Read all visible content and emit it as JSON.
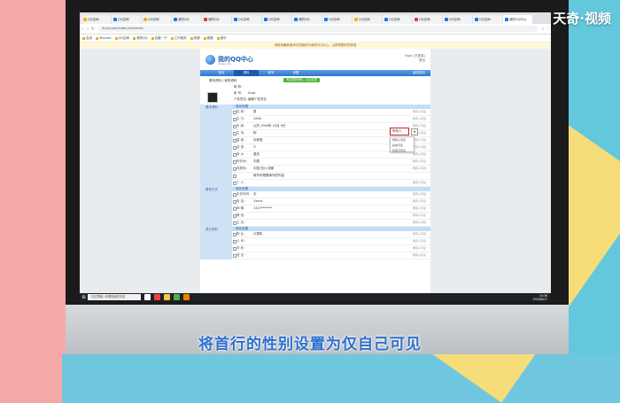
{
  "overlay": {
    "watermark": "天奇·视频",
    "caption": "将首行的性别设置为仅自己可见"
  },
  "browser": {
    "tabs": [
      {
        "label": "QQ空间",
        "color": "#f2b400"
      },
      {
        "label": "QQ空间",
        "color": "#1a73e8"
      },
      {
        "label": "QQ空间",
        "color": "#f2b400"
      },
      {
        "label": "我的QQ",
        "color": "#1a73e8"
      },
      {
        "label": "我的QQ",
        "color": "#e53935"
      },
      {
        "label": "QQ空间",
        "color": "#1a73e8"
      },
      {
        "label": "QQ空间",
        "color": "#1a73e8"
      },
      {
        "label": "我的QQ",
        "color": "#1a73e8"
      },
      {
        "label": "QQ空间",
        "color": "#1a73e8"
      },
      {
        "label": "QQ空间",
        "color": "#f2b400"
      },
      {
        "label": "QQ空间",
        "color": "#1a73e8"
      },
      {
        "label": "QQ空间",
        "color": "#e53935"
      },
      {
        "label": "QQ空间",
        "color": "#1a73e8"
      },
      {
        "label": "QQ空间",
        "color": "#1a73e8"
      },
      {
        "label": "我的QQ中心",
        "color": "#1a73e8"
      }
    ],
    "url": "id.qq.com/index.html#info",
    "bookmarks": [
      "应用",
      "Tencent",
      "QQ空间",
      "我的QQ",
      "百度一下",
      "工作相关",
      "资源",
      "视频",
      "音乐"
    ],
    "notice": "请使用最新版本浏览器访问我的QQ中心，以获得更好的体验"
  },
  "qq": {
    "title": "我的QQ中心",
    "subtitle": "id.qq.com",
    "user_right": "Nupt (已登录)",
    "user_right2": "退出",
    "nav": [
      "首页",
      "资料",
      "帐号",
      "设置"
    ],
    "nav_right": "返回首页",
    "breadcrumb": "基本资料  |  我的资料",
    "green_button": "完善更多资料，点击这里",
    "profile": {
      "nick_label": "昵  称：",
      "nick_value": "",
      "account_label": "帐  号：",
      "account_value": "Nupt",
      "sign_label": "个性签名：",
      "sign_value": "编辑个性签名"
    },
    "sections": [
      {
        "name": "基本资料",
        "header": "保存设置",
        "rows": [
          {
            "label": "性  别：",
            "value": "男",
            "vis": "所有人可见"
          },
          {
            "label": "生  日：",
            "value": "1994",
            "vis": "所有人可见"
          },
          {
            "label": "年  龄：",
            "value": "公历 1994年 10月 9日",
            "vis": "所有人可见"
          },
          {
            "label": "生  肖：",
            "value": "狗",
            "vis": "所有人可见"
          },
          {
            "label": "星  座：",
            "value": "天秤座",
            "vis": "所有人可见"
          },
          {
            "label": "血  型：",
            "value": "O",
            "vis": "所有人可见"
          },
          {
            "label": "家  乡：",
            "value": "重庆",
            "vis": "所有人可见"
          },
          {
            "label": "所在地：",
            "value": "中国",
            "vis": "所有人可见"
          },
          {
            "label": "现居地：",
            "value": "中国 四川 成都",
            "vis": "所有人可见"
          },
          {
            "label": "",
            "value": "填写你想要填写的内容",
            "vis": ""
          },
          {
            "label": "个  人：",
            "value": "",
            "vis": "所有人可见"
          }
        ]
      },
      {
        "name": "联系方式",
        "header": "保存设置",
        "rows": [
          {
            "label": "手机号码：",
            "value": "无",
            "vis": "所有人可见"
          },
          {
            "label": "电  话：",
            "value": "1xxxx",
            "vis": "所有人可见"
          },
          {
            "label": "邮  箱：",
            "value": "1247*******",
            "vis": "所有人可见"
          },
          {
            "label": "微  信：",
            "value": "",
            "vis": "所有人可见"
          },
          {
            "label": "主  页：",
            "value": "",
            "vis": "所有人可见"
          }
        ]
      },
      {
        "name": "其它资料",
        "header": "保存设置",
        "rows": [
          {
            "label": "职  业：",
            "value": "计算机",
            "vis": "所有人可见"
          },
          {
            "label": "公  司：",
            "value": "",
            "vis": "所有人可见"
          },
          {
            "label": "学  校：",
            "value": "",
            "vis": "所有人可见"
          },
          {
            "label": "语  言：",
            "value": "",
            "vis": "所有人可见"
          }
        ]
      }
    ],
    "visibility_select": {
      "selected": "所有人",
      "options": [
        "所有人可见",
        "好友可见",
        "仅自己可见"
      ]
    }
  },
  "taskbar": {
    "search_placeholder": "在这里输入你要搜索的内容",
    "time": "10:36",
    "date": "2020/6/17",
    "apps": [
      "#ffffff",
      "#e8453c",
      "#f2c94c",
      "#4caf50",
      "#f57c00"
    ]
  }
}
